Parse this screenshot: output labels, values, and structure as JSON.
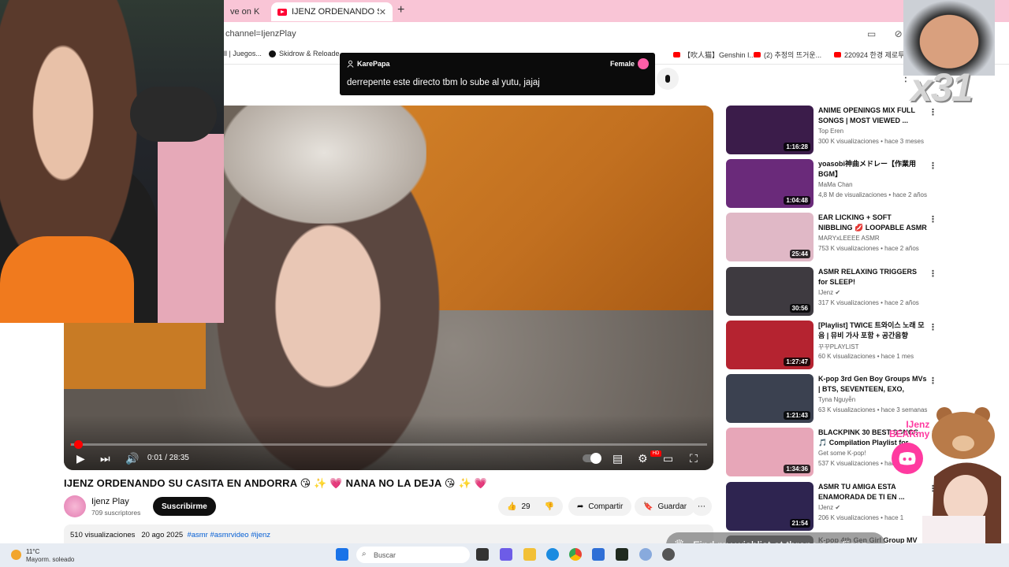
{
  "browser": {
    "tabs": [
      {
        "label": "ve on K"
      },
      {
        "label": "IJENZ ORDENANDO SU CASITA"
      }
    ],
    "url": "channel=IjenzPlay",
    "bookmarks": [
      {
        "label": "ll | Juegos..."
      },
      {
        "label": "Skidrow & Reloade..."
      },
      {
        "label": "【吹人猫】Genshin I..."
      },
      {
        "label": "(2) 추정의 뜨거운..."
      },
      {
        "label": "220924 한경 제로투..."
      }
    ]
  },
  "video": {
    "title": "IJENZ ORDENANDO SU CASITA EN ANDORRA 😘 ✨ 💗 NANA NO LA DEJA 😘 ✨ 💗",
    "progress_fraction": 0.0006,
    "time": "0:01 / 28:35",
    "channel": "Ijenz Play",
    "subscribers": "709 suscriptores",
    "subscribe_label": "Suscribirme",
    "likes": "29",
    "share_label": "Compartir",
    "save_label": "Guardar",
    "views": "510 visualizaciones",
    "date": "20 ago 2025",
    "tags": "#asmr #asmrvideo #ijenz"
  },
  "recommendations": [
    {
      "title": "ANIME OPENINGS MIX FULL SONGS | MOST VIEWED ...",
      "channel": "Top Eren",
      "views": "300 K visualizaciones • hace 3 meses",
      "duration": "1:16:28",
      "thumb_color": "#3b1c4a"
    },
    {
      "title": "yoasobi神曲メドレー【作業用BGM】",
      "channel": "MaMa Chan",
      "views": "4,8 M de visualizaciones • hace 2 años",
      "duration": "1:04:48",
      "thumb_color": "#6a2a7a"
    },
    {
      "title": "EAR LICKING + SOFT NIBBLING 💋 LOOPABLE ASMR | No ...",
      "channel": "MARYxLEEEE ASMR",
      "views": "753 K visualizaciones • hace 2 años",
      "duration": "25:44",
      "thumb_color": "#e0b8c6"
    },
    {
      "title": "ASMR RELAXING TRIGGERS for SLEEP!",
      "channel": "IJenz ✔",
      "views": "317 K visualizaciones • hace 2 años",
      "duration": "30:56",
      "thumb_color": "#3e3a40"
    },
    {
      "title": "[Playlist] TWICE 트와이스 노래 모음 | 뮤비 가사 포함 + 공간음향",
      "channel": "꾸꾸PLAYLIST",
      "views": "60 K visualizaciones • hace 1 mes",
      "duration": "1:27:47",
      "thumb_color": "#b52330"
    },
    {
      "title": "K-pop 3rd Gen Boy Groups MVs | BTS, SEVENTEEN, EXO, GOT7...",
      "channel": "Tyna Nguyễn",
      "views": "63 K visualizaciones • hace 3 semanas",
      "duration": "1:21:43",
      "thumb_color": "#3b4150"
    },
    {
      "title": "BLACKPINK 30 BEST SONGS 🎵 Compilation Playlist for...",
      "channel": "Get some K-pop!",
      "views": "537 K visualizaciones • hace 2 años",
      "duration": "1:34:36",
      "thumb_color": "#e7a6b8"
    },
    {
      "title": "ASMR TU AMIGA ESTA ENAMORADA DE TI EN ...",
      "channel": "IJenz ✔",
      "views": "206 K visualizaciones • hace 1",
      "duration": "21:54",
      "thumb_color": "#2e2450"
    },
    {
      "title": "K-pop 4th Gen Girl Group MV",
      "channel": "",
      "views": "",
      "duration": "",
      "thumb_color": "#222"
    }
  ],
  "overlay": {
    "chat_user": "KarePapa",
    "chat_gender": "Female",
    "chat_message": "derrepente este directo tbm lo sube al yutu, jajaj",
    "multiplier": "x31",
    "brand_top": "IJenz",
    "brand_bottom": "BEARmy",
    "throne": "Find my wishlist at throne.com/ijenz"
  },
  "taskbar": {
    "temp": "11°C",
    "condition": "Mayorm. soleado",
    "search": "Buscar"
  },
  "colors": {
    "accent": "#ff0000",
    "tab_bar": "#f9c5d6",
    "brand_pink": "#ff3aa0"
  }
}
